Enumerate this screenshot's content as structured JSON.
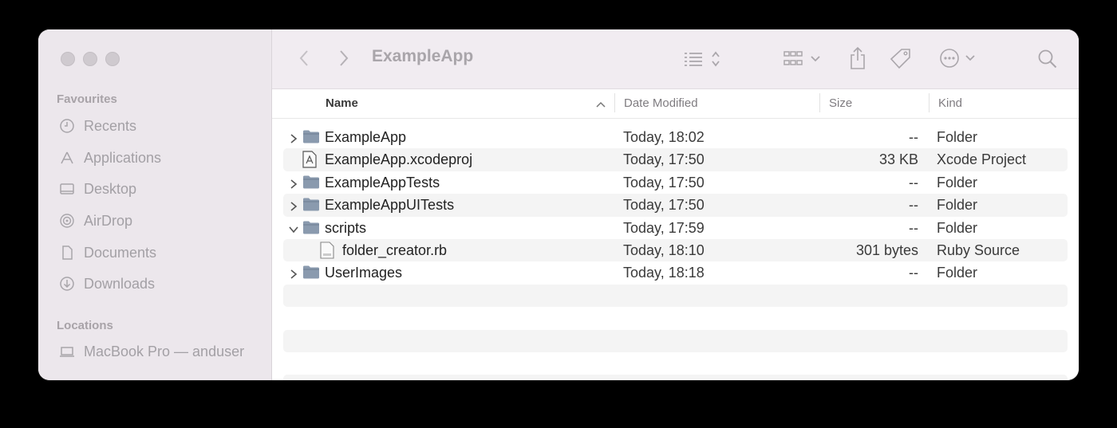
{
  "window": {
    "title": "ExampleApp"
  },
  "sidebar": {
    "favourites_header": "Favourites",
    "favourites": [
      {
        "label": "Recents",
        "icon": "clock-icon"
      },
      {
        "label": "Applications",
        "icon": "applications-icon"
      },
      {
        "label": "Desktop",
        "icon": "desktop-icon"
      },
      {
        "label": "AirDrop",
        "icon": "airdrop-icon"
      },
      {
        "label": "Documents",
        "icon": "document-icon"
      },
      {
        "label": "Downloads",
        "icon": "download-icon"
      }
    ],
    "locations_header": "Locations",
    "locations": [
      {
        "label": "MacBook Pro — anduser",
        "icon": "laptop-icon"
      }
    ]
  },
  "toolbar": {
    "icons": [
      "back-icon",
      "forward-icon",
      "list-view-icon",
      "group-icon",
      "share-icon",
      "tag-icon",
      "more-icon",
      "search-icon"
    ]
  },
  "columns": {
    "name": "Name",
    "date": "Date Modified",
    "size": "Size",
    "kind": "Kind"
  },
  "files": [
    {
      "name": "ExampleApp",
      "date": "Today, 18:02",
      "size": "--",
      "kind": "Folder",
      "type": "folder",
      "expanded": false,
      "indent": 0
    },
    {
      "name": "ExampleApp.xcodeproj",
      "date": "Today, 17:50",
      "size": "33 KB",
      "kind": "Xcode Project",
      "type": "xcodeproj",
      "expanded": null,
      "indent": 0
    },
    {
      "name": "ExampleAppTests",
      "date": "Today, 17:50",
      "size": "--",
      "kind": "Folder",
      "type": "folder",
      "expanded": false,
      "indent": 0
    },
    {
      "name": "ExampleAppUITests",
      "date": "Today, 17:50",
      "size": "--",
      "kind": "Folder",
      "type": "folder",
      "expanded": false,
      "indent": 0
    },
    {
      "name": "scripts",
      "date": "Today, 17:59",
      "size": "--",
      "kind": "Folder",
      "type": "folder",
      "expanded": true,
      "indent": 0
    },
    {
      "name": "folder_creator.rb",
      "date": "Today, 18:10",
      "size": "301 bytes",
      "kind": "Ruby Source",
      "type": "ruby",
      "expanded": null,
      "indent": 1
    },
    {
      "name": "UserImages",
      "date": "Today, 18:18",
      "size": "--",
      "kind": "Folder",
      "type": "folder",
      "expanded": false,
      "indent": 0
    }
  ],
  "colors": {
    "folder": "#8a9aae",
    "selection": "#f4f4f4"
  }
}
